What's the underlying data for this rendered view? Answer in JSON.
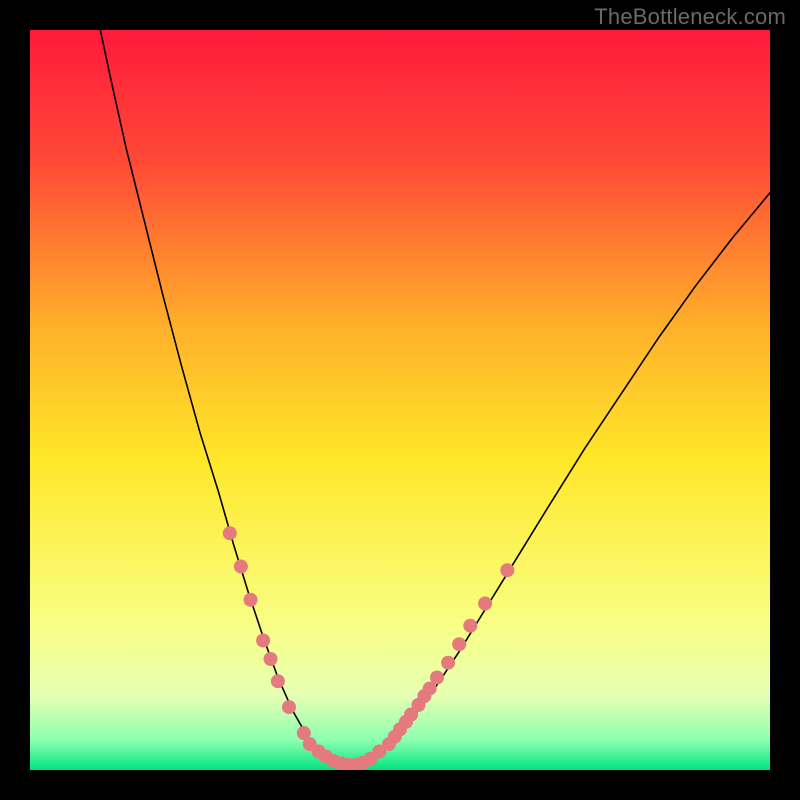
{
  "watermark": "TheBottleneck.com",
  "chart_data": {
    "type": "line",
    "title": "",
    "xlabel": "",
    "ylabel": "",
    "xlim": [
      0,
      100
    ],
    "ylim": [
      0,
      100
    ],
    "grid": false,
    "legend": false,
    "gradient_stops": [
      {
        "offset": 0.0,
        "color": "#ff1a3b"
      },
      {
        "offset": 0.18,
        "color": "#ff4a36"
      },
      {
        "offset": 0.4,
        "color": "#ffb02a"
      },
      {
        "offset": 0.58,
        "color": "#ffe728"
      },
      {
        "offset": 0.8,
        "color": "#f9ff83"
      },
      {
        "offset": 0.9,
        "color": "#e6ffb3"
      },
      {
        "offset": 0.96,
        "color": "#8bffb0"
      },
      {
        "offset": 1.0,
        "color": "#00e57f"
      }
    ],
    "series": [
      {
        "name": "left-curve",
        "stroke": "#000000",
        "stroke_width": 1.6,
        "points": [
          {
            "x": 9.5,
            "y": 100.0
          },
          {
            "x": 11.0,
            "y": 93.0
          },
          {
            "x": 13.0,
            "y": 84.0
          },
          {
            "x": 15.5,
            "y": 74.0
          },
          {
            "x": 18.0,
            "y": 64.0
          },
          {
            "x": 20.5,
            "y": 54.5
          },
          {
            "x": 23.0,
            "y": 45.5
          },
          {
            "x": 25.5,
            "y": 37.5
          },
          {
            "x": 27.5,
            "y": 30.5
          },
          {
            "x": 29.5,
            "y": 24.0
          },
          {
            "x": 31.5,
            "y": 18.0
          },
          {
            "x": 33.5,
            "y": 12.5
          },
          {
            "x": 35.5,
            "y": 8.0
          },
          {
            "x": 37.5,
            "y": 4.5
          },
          {
            "x": 39.5,
            "y": 2.2
          },
          {
            "x": 41.5,
            "y": 1.0
          },
          {
            "x": 43.5,
            "y": 0.6
          }
        ]
      },
      {
        "name": "right-curve",
        "stroke": "#000000",
        "stroke_width": 1.6,
        "points": [
          {
            "x": 43.5,
            "y": 0.6
          },
          {
            "x": 46.0,
            "y": 1.5
          },
          {
            "x": 49.0,
            "y": 4.0
          },
          {
            "x": 52.0,
            "y": 7.5
          },
          {
            "x": 55.0,
            "y": 11.5
          },
          {
            "x": 58.0,
            "y": 16.0
          },
          {
            "x": 62.0,
            "y": 22.5
          },
          {
            "x": 66.0,
            "y": 29.0
          },
          {
            "x": 70.0,
            "y": 35.5
          },
          {
            "x": 75.0,
            "y": 43.5
          },
          {
            "x": 80.0,
            "y": 51.0
          },
          {
            "x": 85.0,
            "y": 58.5
          },
          {
            "x": 90.0,
            "y": 65.5
          },
          {
            "x": 95.0,
            "y": 72.0
          },
          {
            "x": 100.0,
            "y": 78.0
          }
        ]
      }
    ],
    "marker_color": "#e47a7d",
    "marker_radius": 7,
    "markers_left": [
      {
        "x": 27.0,
        "y": 32.0
      },
      {
        "x": 28.5,
        "y": 27.5
      },
      {
        "x": 29.8,
        "y": 23.0
      },
      {
        "x": 31.5,
        "y": 17.5
      },
      {
        "x": 32.5,
        "y": 15.0
      },
      {
        "x": 33.5,
        "y": 12.0
      },
      {
        "x": 35.0,
        "y": 8.5
      },
      {
        "x": 37.0,
        "y": 5.0
      },
      {
        "x": 37.8,
        "y": 3.5
      },
      {
        "x": 39.0,
        "y": 2.5
      },
      {
        "x": 40.0,
        "y": 1.8
      },
      {
        "x": 41.0,
        "y": 1.2
      },
      {
        "x": 42.0,
        "y": 0.9
      },
      {
        "x": 43.0,
        "y": 0.7
      },
      {
        "x": 44.0,
        "y": 0.7
      },
      {
        "x": 45.0,
        "y": 1.0
      },
      {
        "x": 46.0,
        "y": 1.5
      },
      {
        "x": 47.2,
        "y": 2.5
      }
    ],
    "markers_right": [
      {
        "x": 48.5,
        "y": 3.5
      },
      {
        "x": 49.3,
        "y": 4.5
      },
      {
        "x": 50.0,
        "y": 5.5
      },
      {
        "x": 50.8,
        "y": 6.5
      },
      {
        "x": 51.5,
        "y": 7.5
      },
      {
        "x": 52.5,
        "y": 8.8
      },
      {
        "x": 53.3,
        "y": 10.0
      },
      {
        "x": 54.0,
        "y": 11.0
      },
      {
        "x": 55.0,
        "y": 12.5
      },
      {
        "x": 56.5,
        "y": 14.5
      },
      {
        "x": 58.0,
        "y": 17.0
      },
      {
        "x": 59.5,
        "y": 19.5
      },
      {
        "x": 61.5,
        "y": 22.5
      },
      {
        "x": 64.5,
        "y": 27.0
      }
    ]
  }
}
